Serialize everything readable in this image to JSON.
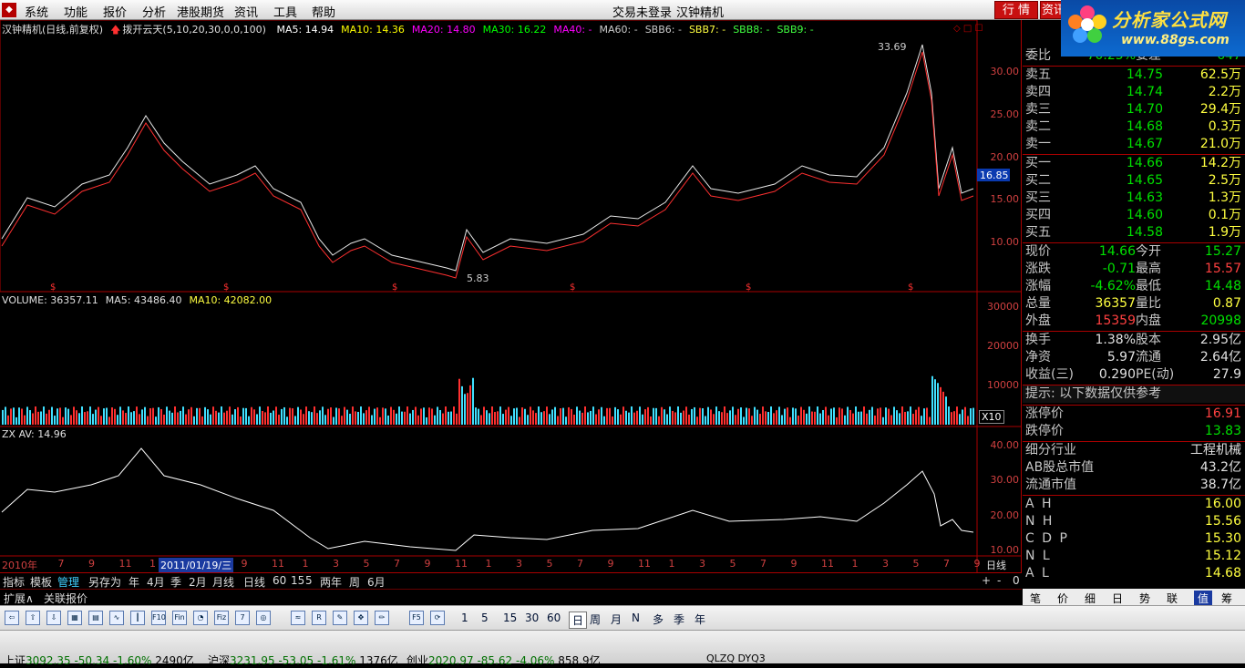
{
  "menu": {
    "items": [
      "系统",
      "功能",
      "报价",
      "分析",
      "港股期货",
      "资讯",
      "工具",
      "帮助"
    ],
    "login_status": "交易未登录",
    "stock_name": "汉钟精机",
    "btn_market": "行 情",
    "btn_info": "资讯"
  },
  "logo": {
    "title": "分析家公式网",
    "url": "www.88gs.com"
  },
  "main_chart": {
    "title": "汉钟精机(日线,前复权)",
    "indicator_name": "拨开云天(5,10,20,30,0,0,100)",
    "ma": [
      {
        "label": "MA5: 14.94",
        "color": "#ffffff"
      },
      {
        "label": "MA10: 14.36",
        "color": "#ffff00"
      },
      {
        "label": "MA20: 14.80",
        "color": "#ff00ff"
      },
      {
        "label": "MA30: 16.22",
        "color": "#00ff00"
      },
      {
        "label": "MA40: -",
        "color": "#ff00ff"
      },
      {
        "label": "MA60: -",
        "color": "#cccccc"
      },
      {
        "label": "SBB6: -",
        "color": "#cccccc"
      },
      {
        "label": "SBB7: -",
        "color": "#ffff40"
      },
      {
        "label": "SBB8: -",
        "color": "#40ff40"
      },
      {
        "label": "SBB9: -",
        "color": "#40ff40"
      }
    ],
    "y_ticks": [
      "30.00",
      "25.00",
      "20.00",
      "15.00",
      "10.00"
    ],
    "high_label": "33.69",
    "low_label": "5.83",
    "current_price_tag": "16.85"
  },
  "volume": {
    "title": "VOLUME: 36357.11",
    "ma5": "MA5: 43486.40",
    "ma10": "MA10: 42082.00",
    "y_ticks": [
      "30000",
      "20000",
      "10000"
    ],
    "unit": "X10"
  },
  "zx": {
    "title": "ZX AV: 14.96",
    "y_ticks": [
      "40.00",
      "30.00",
      "20.00",
      "10.00"
    ]
  },
  "x_axis": {
    "labels": [
      "2010年",
      "7",
      "9",
      "11",
      "1",
      "3",
      "7",
      "9",
      "11",
      "1",
      "3",
      "5",
      "7",
      "9",
      "11",
      "1",
      "3",
      "5",
      "7",
      "9",
      "11",
      "1",
      "3",
      "5",
      "7",
      "9",
      "11",
      "1",
      "3",
      "5",
      "7",
      "9"
    ],
    "cursor_date": "2011/01/19/三",
    "period": "日线"
  },
  "bottom_tabs": [
    "指标",
    "模板",
    "管理",
    "另存为",
    "年",
    "4月",
    "季",
    "2月",
    "月线",
    "日线",
    "60",
    "15",
    "5",
    "两年",
    "周",
    "6月"
  ],
  "bottom_right": [
    "+",
    "-",
    "0"
  ],
  "ext_row": [
    "扩展∧",
    "关联报价"
  ],
  "right_panel": {
    "weibi": {
      "label": "委比",
      "value": "-70.25%",
      "label2": "委差",
      "value2": "-647"
    },
    "sell": [
      {
        "label": "卖五",
        "price": "14.75",
        "vol": "62.5万"
      },
      {
        "label": "卖四",
        "price": "14.74",
        "vol": "2.2万"
      },
      {
        "label": "卖三",
        "price": "14.70",
        "vol": "29.4万"
      },
      {
        "label": "卖二",
        "price": "14.68",
        "vol": "0.3万"
      },
      {
        "label": "卖一",
        "price": "14.67",
        "vol": "21.0万"
      }
    ],
    "buy": [
      {
        "label": "买一",
        "price": "14.66",
        "vol": "14.2万"
      },
      {
        "label": "买二",
        "price": "14.65",
        "vol": "2.5万"
      },
      {
        "label": "买三",
        "price": "14.63",
        "vol": "1.3万"
      },
      {
        "label": "买四",
        "price": "14.60",
        "vol": "0.1万"
      },
      {
        "label": "买五",
        "price": "14.58",
        "vol": "1.9万"
      }
    ],
    "quote1": [
      {
        "l1": "现价",
        "v1": "14.66",
        "c1": "#00e000",
        "l2": "今开",
        "v2": "15.27",
        "c2": "#00e000"
      },
      {
        "l1": "涨跌",
        "v1": "-0.71",
        "c1": "#00e000",
        "l2": "最高",
        "v2": "15.57",
        "c2": "#ff4040"
      },
      {
        "l1": "涨幅",
        "v1": "-4.62%",
        "c1": "#00e000",
        "l2": "最低",
        "v2": "14.48",
        "c2": "#00e000"
      },
      {
        "l1": "总量",
        "v1": "36357",
        "c1": "#ffff40",
        "l2": "量比",
        "v2": "0.87",
        "c2": "#ffff40"
      },
      {
        "l1": "外盘",
        "v1": "15359",
        "c1": "#ff4040",
        "l2": "内盘",
        "v2": "20998",
        "c2": "#00e000"
      }
    ],
    "quote2": [
      {
        "l1": "换手",
        "v1": "1.38%",
        "c1": "#e0e0e0",
        "l2": "股本",
        "v2": "2.95亿",
        "c2": "#e0e0e0"
      },
      {
        "l1": "净资",
        "v1": "5.97",
        "c1": "#e0e0e0",
        "l2": "流通",
        "v2": "2.64亿",
        "c2": "#e0e0e0"
      },
      {
        "l1": "收益(三)",
        "v1": "0.290",
        "c1": "#e0e0e0",
        "l2": "PE(动)",
        "v2": "27.9",
        "c2": "#e0e0e0"
      }
    ],
    "hint": "提示: 以下数据仅供参考",
    "limits": [
      {
        "label": "涨停价",
        "value": "16.91",
        "color": "#ff4040"
      },
      {
        "label": "跌停价",
        "value": "13.83",
        "color": "#00e000"
      }
    ],
    "industry": [
      {
        "label": "细分行业",
        "value": "工程机械"
      },
      {
        "label": "AB股总市值",
        "value": "43.2亿"
      },
      {
        "label": "流通市值",
        "value": "38.7亿"
      }
    ],
    "indices": [
      {
        "label": "A H",
        "value": "16.00"
      },
      {
        "label": "N H",
        "value": "15.56"
      },
      {
        "label": "C D P",
        "value": "15.30"
      },
      {
        "label": "N L",
        "value": "15.12"
      },
      {
        "label": "A L",
        "value": "14.68"
      }
    ],
    "tabs": [
      "笔",
      "价",
      "细",
      "日",
      "势",
      "联",
      "值",
      "筹"
    ]
  },
  "toolbar": {
    "icons": [
      "left-arrow-icon",
      "up-arrow-icon",
      "down-arrow-icon",
      "grid-icon",
      "table-icon",
      "line-chart-icon",
      "candle-icon",
      "f10-icon",
      "fin-icon",
      "pie-icon",
      "fiz-icon",
      "f7-icon",
      "refresh-icon",
      "wave-icon",
      "rsi-icon",
      "brush-icon",
      "move-icon",
      "pencil-icon",
      "f5-icon",
      "cycle-icon"
    ],
    "rsi_label": "RSI",
    "periods": [
      "1",
      "5",
      "15",
      "30",
      "60",
      "日",
      "周",
      "月",
      "N",
      "多",
      "季",
      "年"
    ]
  },
  "status": [
    {
      "label": "上证",
      "value": "3092.35",
      "change": "-50.34",
      "pct": "-1.60%",
      "amount": "2490亿"
    },
    {
      "label": "沪深",
      "value": "3231.95",
      "change": "-53.05",
      "pct": "-1.61%",
      "amount": "1376亿"
    },
    {
      "label": "创业",
      "value": "2020.97",
      "change": "-85.62",
      "pct": "-4.06%",
      "amount": "858.9亿"
    }
  ],
  "status_right": "QLZQ DYQ3"
}
